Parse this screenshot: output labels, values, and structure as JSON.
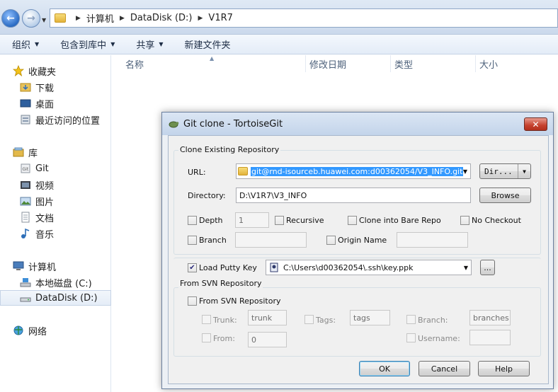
{
  "address": {
    "path": [
      "计算机",
      "DataDisk (D:)",
      "V1R7"
    ]
  },
  "toolbar": {
    "organize": "组织",
    "include_library": "包含到库中",
    "share": "共享",
    "new_folder": "新建文件夹"
  },
  "columns": [
    "名称",
    "修改日期",
    "类型",
    "大小"
  ],
  "nav": {
    "favorites": "收藏夹",
    "downloads": "下载",
    "desktop": "桌面",
    "recent": "最近访问的位置",
    "libraries": "库",
    "git": "Git",
    "videos": "视频",
    "pictures": "图片",
    "documents": "文档",
    "music": "音乐",
    "computer": "计算机",
    "local_disk": "本地磁盘 (C:)",
    "data_disk": "DataDisk (D:)",
    "network": "网络"
  },
  "dialog": {
    "title": "Git clone - TortoiseGit",
    "close": "✕",
    "clone_group": "Clone Existing Repository",
    "url_label": "URL:",
    "url_value": "git@rnd-isourceb.huawei.com:d00362054/V3_INFO.git",
    "dir_button": "Dir...",
    "directory_label": "Directory:",
    "directory_value": "D:\\V1R7\\V3_INFO",
    "browse_button": "Browse",
    "depth_label": "Depth",
    "depth_value": "1",
    "recursive_label": "Recursive",
    "bare_label": "Clone into Bare Repo",
    "no_checkout_label": "No Checkout",
    "branch_label": "Branch",
    "origin_label": "Origin Name",
    "putty_label": "Load Putty Key",
    "putty_value": "C:\\Users\\d00362054\\.ssh\\key.ppk",
    "putty_browse": "...",
    "svn_group": "From SVN Repository",
    "svn_checkbox": "From SVN Repository",
    "trunk_label": "Trunk:",
    "trunk_value": "trunk",
    "tags_label": "Tags:",
    "tags_value": "tags",
    "branch_svn_label": "Branch:",
    "branch_svn_value": "branches",
    "from_label": "From:",
    "from_value": "0",
    "username_label": "Username:",
    "ok": "OK",
    "cancel": "Cancel",
    "help": "Help"
  }
}
